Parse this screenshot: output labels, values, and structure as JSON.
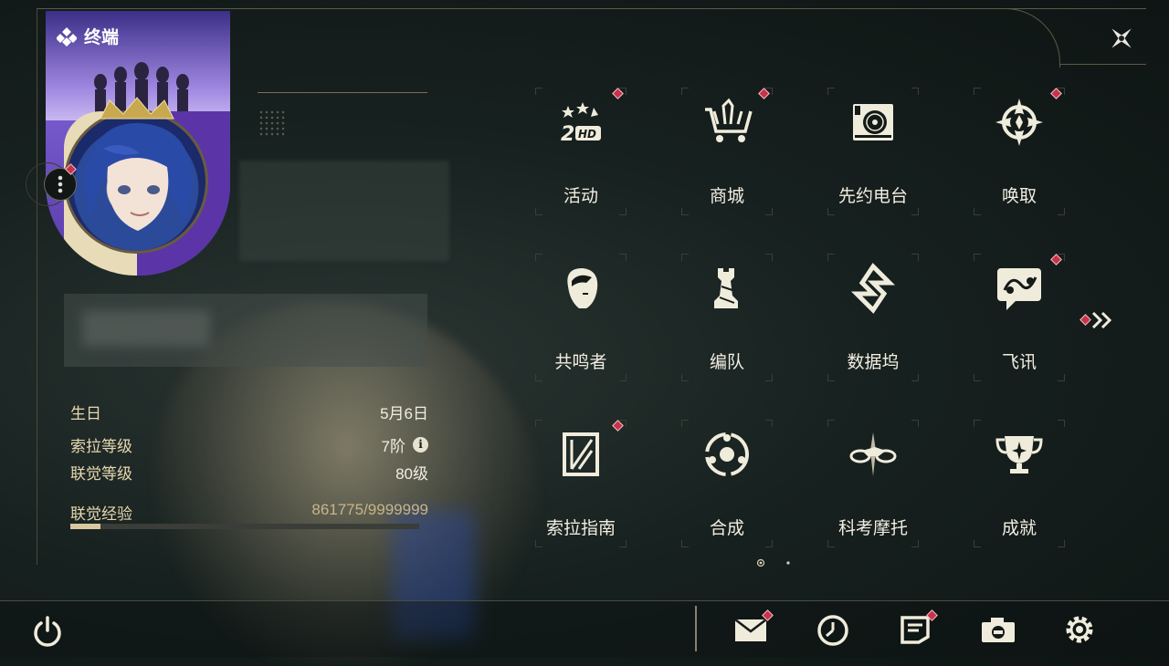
{
  "card": {
    "title": "终端"
  },
  "profile": {
    "stats": [
      {
        "label": "生日",
        "value": "5月6日"
      },
      {
        "label": "索拉等级",
        "value": "7阶"
      },
      {
        "label": "联觉等级",
        "value": "80级"
      }
    ],
    "exp": {
      "label": "联觉经验",
      "value": "861775/9999999",
      "progress": 0.086
    }
  },
  "menu": {
    "items": [
      {
        "label": "活动",
        "icon": "event-2hd-icon",
        "badge": true
      },
      {
        "label": "商城",
        "icon": "shop-cart-icon",
        "badge": true
      },
      {
        "label": "先约电台",
        "icon": "radio-icon",
        "badge": false
      },
      {
        "label": "唤取",
        "icon": "gacha-compass-icon",
        "badge": true
      },
      {
        "label": "共鸣者",
        "icon": "resonator-head-icon",
        "badge": false
      },
      {
        "label": "编队",
        "icon": "chess-team-icon",
        "badge": false
      },
      {
        "label": "数据坞",
        "icon": "data-dock-icon",
        "badge": false
      },
      {
        "label": "飞讯",
        "icon": "message-chat-icon",
        "badge": true
      },
      {
        "label": "索拉指南",
        "icon": "guide-book-icon",
        "badge": true
      },
      {
        "label": "合成",
        "icon": "synthesis-icon",
        "badge": false
      },
      {
        "label": "科考摩托",
        "icon": "motorbike-icon",
        "badge": false
      },
      {
        "label": "成就",
        "icon": "trophy-icon",
        "badge": false
      }
    ],
    "page_count": 2,
    "current_page": 1
  },
  "bottom": {
    "icons": [
      "mail-icon",
      "clock-icon",
      "notes-icon",
      "camera-icon",
      "settings-gear-icon"
    ]
  },
  "colors": {
    "badge": "#c8324a",
    "accent": "#d8c8a0",
    "text": "#f2eee2"
  }
}
